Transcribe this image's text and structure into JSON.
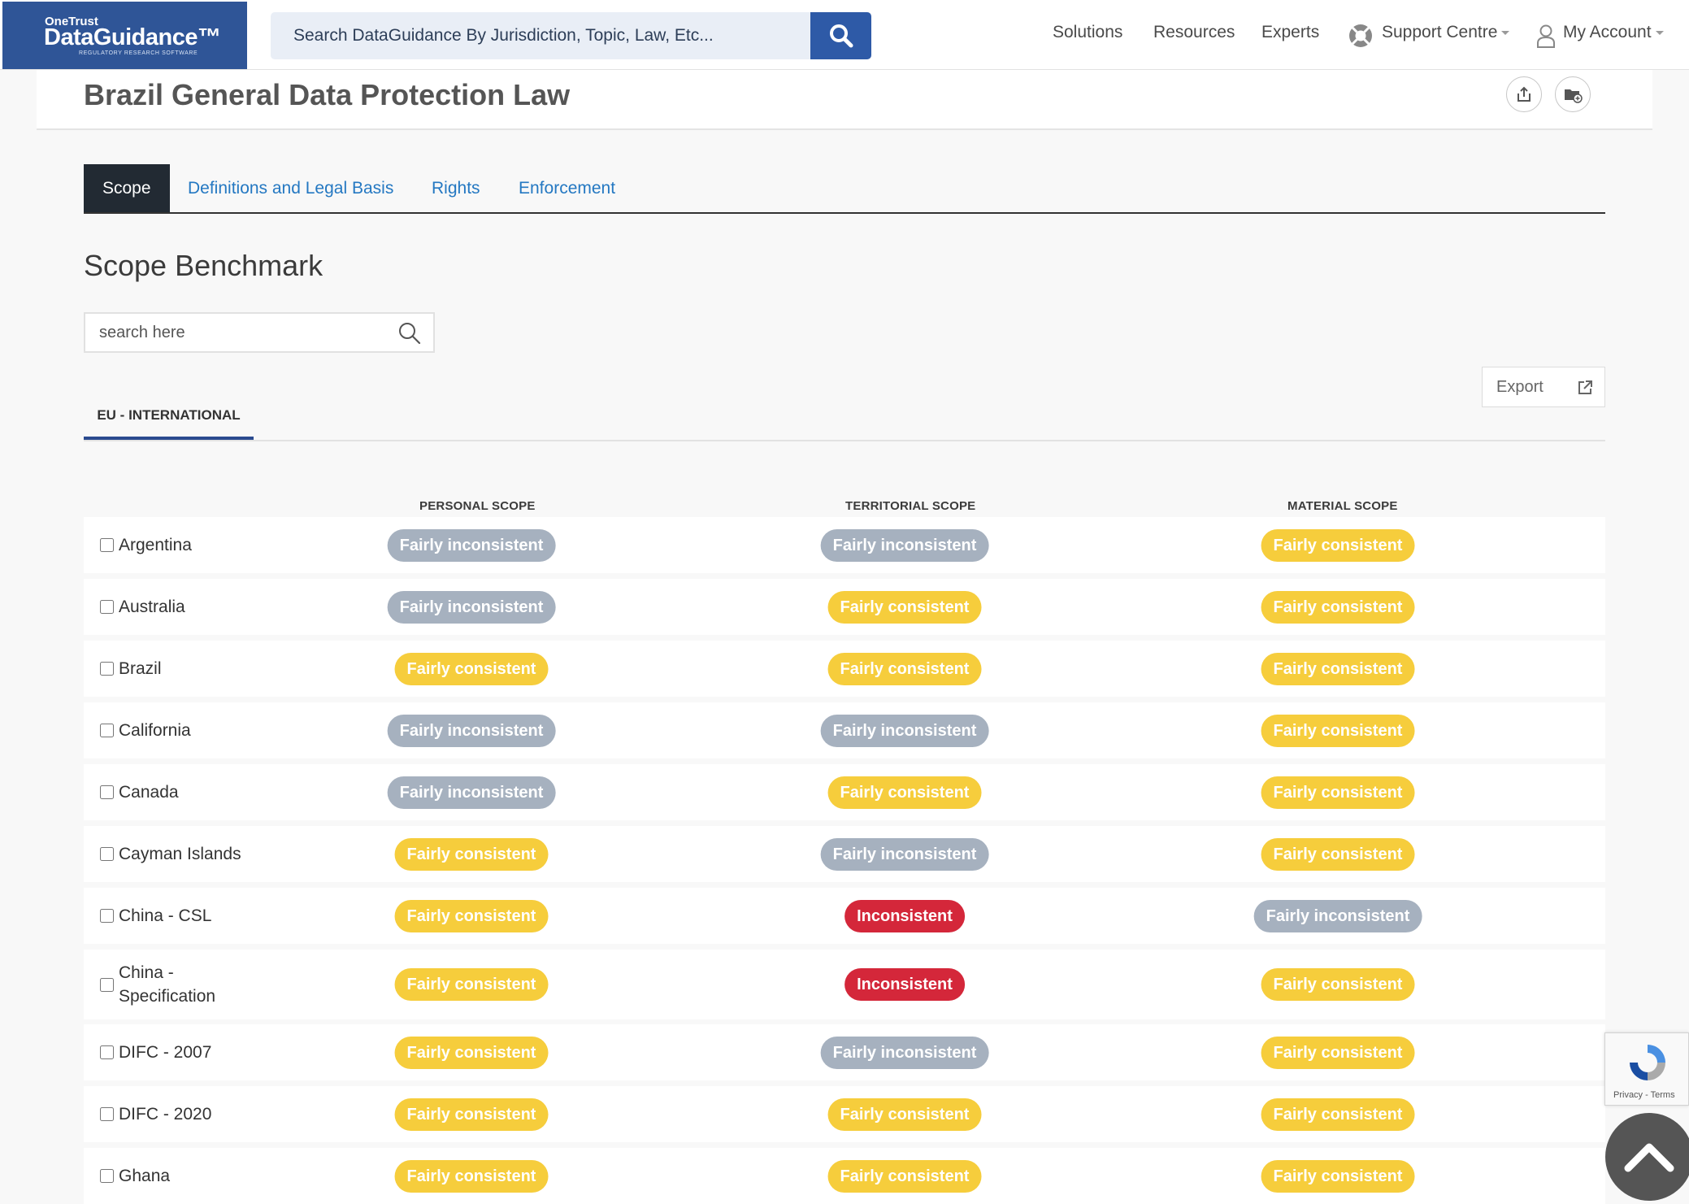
{
  "brand": {
    "top": "OneTrust",
    "name": "DataGuidance™",
    "tagline": "REGULATORY RESEARCH SOFTWARE"
  },
  "search": {
    "placeholder": "Search DataGuidance By Jurisdiction, Topic, Law, Etc..."
  },
  "nav": {
    "solutions": "Solutions",
    "resources": "Resources",
    "experts": "Experts",
    "support": "Support Centre",
    "account": "My Account"
  },
  "page": {
    "title": "Brazil General Data Protection Law"
  },
  "tabs": [
    "Scope",
    "Definitions and Legal Basis",
    "Rights",
    "Enforcement"
  ],
  "section": {
    "title": "Scope Benchmark",
    "search_placeholder": "search here",
    "export_label": "Export",
    "region_tab": "EU - INTERNATIONAL"
  },
  "columns": [
    "PERSONAL SCOPE",
    "TERRITORIAL SCOPE",
    "MATERIAL SCOPE"
  ],
  "rows": [
    {
      "name": "Argentina",
      "personal": "Fairly inconsistent",
      "territorial": "Fairly inconsistent",
      "material": "Fairly consistent"
    },
    {
      "name": "Australia",
      "personal": "Fairly inconsistent",
      "territorial": "Fairly consistent",
      "material": "Fairly consistent"
    },
    {
      "name": "Brazil",
      "personal": "Fairly consistent",
      "territorial": "Fairly consistent",
      "material": "Fairly consistent"
    },
    {
      "name": "California",
      "personal": "Fairly inconsistent",
      "territorial": "Fairly inconsistent",
      "material": "Fairly consistent"
    },
    {
      "name": "Canada",
      "personal": "Fairly inconsistent",
      "territorial": "Fairly consistent",
      "material": "Fairly consistent"
    },
    {
      "name": "Cayman Islands",
      "personal": "Fairly consistent",
      "territorial": "Fairly inconsistent",
      "material": "Fairly consistent"
    },
    {
      "name": "China - CSL",
      "personal": "Fairly consistent",
      "territorial": "Inconsistent",
      "material": "Fairly inconsistent"
    },
    {
      "name": "China - Specification",
      "name_lines": [
        "China -",
        "Specification"
      ],
      "personal": "Fairly consistent",
      "territorial": "Inconsistent",
      "material": "Fairly consistent"
    },
    {
      "name": "DIFC - 2007",
      "personal": "Fairly consistent",
      "territorial": "Fairly inconsistent",
      "material": "Fairly consistent"
    },
    {
      "name": "DIFC - 2020",
      "personal": "Fairly consistent",
      "territorial": "Fairly consistent",
      "material": "Fairly consistent"
    },
    {
      "name": "Ghana",
      "personal": "Fairly consistent",
      "territorial": "Fairly consistent",
      "material": "Fairly consistent"
    }
  ],
  "colors": {
    "brand": "#2f5597",
    "fairly_consistent": "#f6cd3c",
    "fairly_inconsistent": "#a6b1bf",
    "inconsistent": "#d4273a",
    "tab_active": "#222a33",
    "link": "#2478c2"
  },
  "recaptcha": {
    "text": "Privacy - Terms"
  }
}
